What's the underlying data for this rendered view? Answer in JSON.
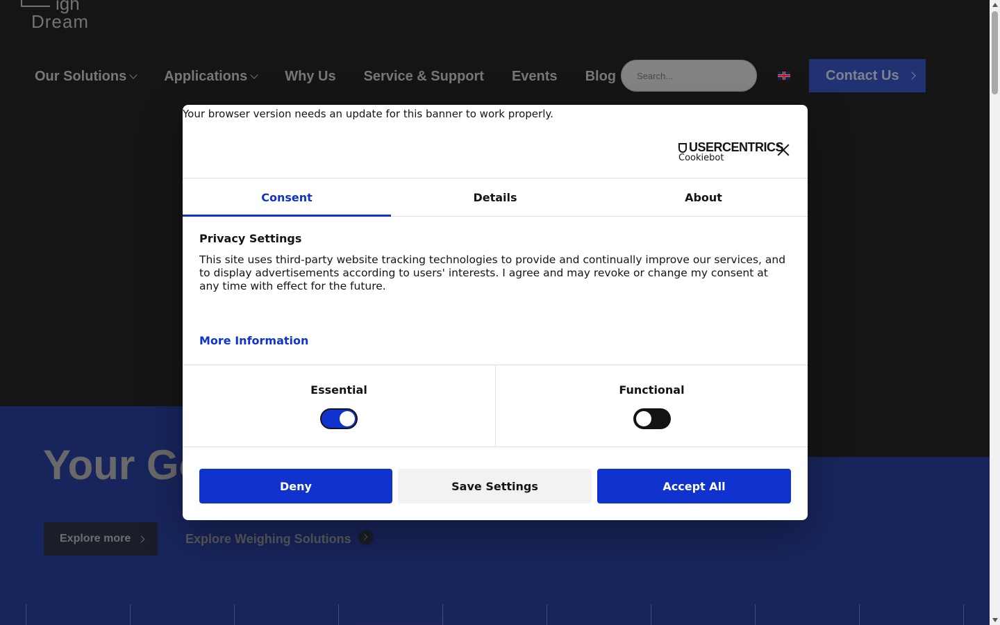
{
  "header": {
    "logo_top": "igh",
    "logo_bottom": "Dream",
    "nav": [
      {
        "label": "Our Solutions",
        "has_dropdown": true
      },
      {
        "label": "Applications",
        "has_dropdown": true
      },
      {
        "label": "Why Us",
        "has_dropdown": false
      },
      {
        "label": "Service & Support",
        "has_dropdown": false
      },
      {
        "label": "Events",
        "has_dropdown": false
      },
      {
        "label": "Blog",
        "has_dropdown": false
      }
    ],
    "search_placeholder": "Search...",
    "language_icon": "uk-flag-icon",
    "contact_label": "Contact Us"
  },
  "hero": {
    "title": "Your Go",
    "explore_label": "Explore more",
    "weighing_label": "Explore Weighing Solutions"
  },
  "cookie_dialog": {
    "warning": "Your browser version needs an update for this banner to work properly.",
    "brand_top": "USERCENTRICS",
    "brand_bottom": "Cookiebot",
    "tabs": [
      {
        "label": "Consent",
        "active": true
      },
      {
        "label": "Details",
        "active": false
      },
      {
        "label": "About",
        "active": false
      }
    ],
    "privacy_title": "Privacy Settings",
    "privacy_body": "This site uses third-party website tracking technologies to provide and continually improve our services, and to display advertisements according to users' interests. I agree and may revoke or change my consent at any time with effect for the future.",
    "more_info": "More Information",
    "toggles": [
      {
        "label": "Essential",
        "on": true
      },
      {
        "label": "Functional",
        "on": false
      }
    ],
    "buttons": {
      "deny": "Deny",
      "save": "Save Settings",
      "accept": "Accept All"
    }
  },
  "colors": {
    "accent": "#1032cf",
    "header_bg": "#272727",
    "hero_blue": "#2d44a8",
    "contact_bg": "#3d5bd1"
  }
}
